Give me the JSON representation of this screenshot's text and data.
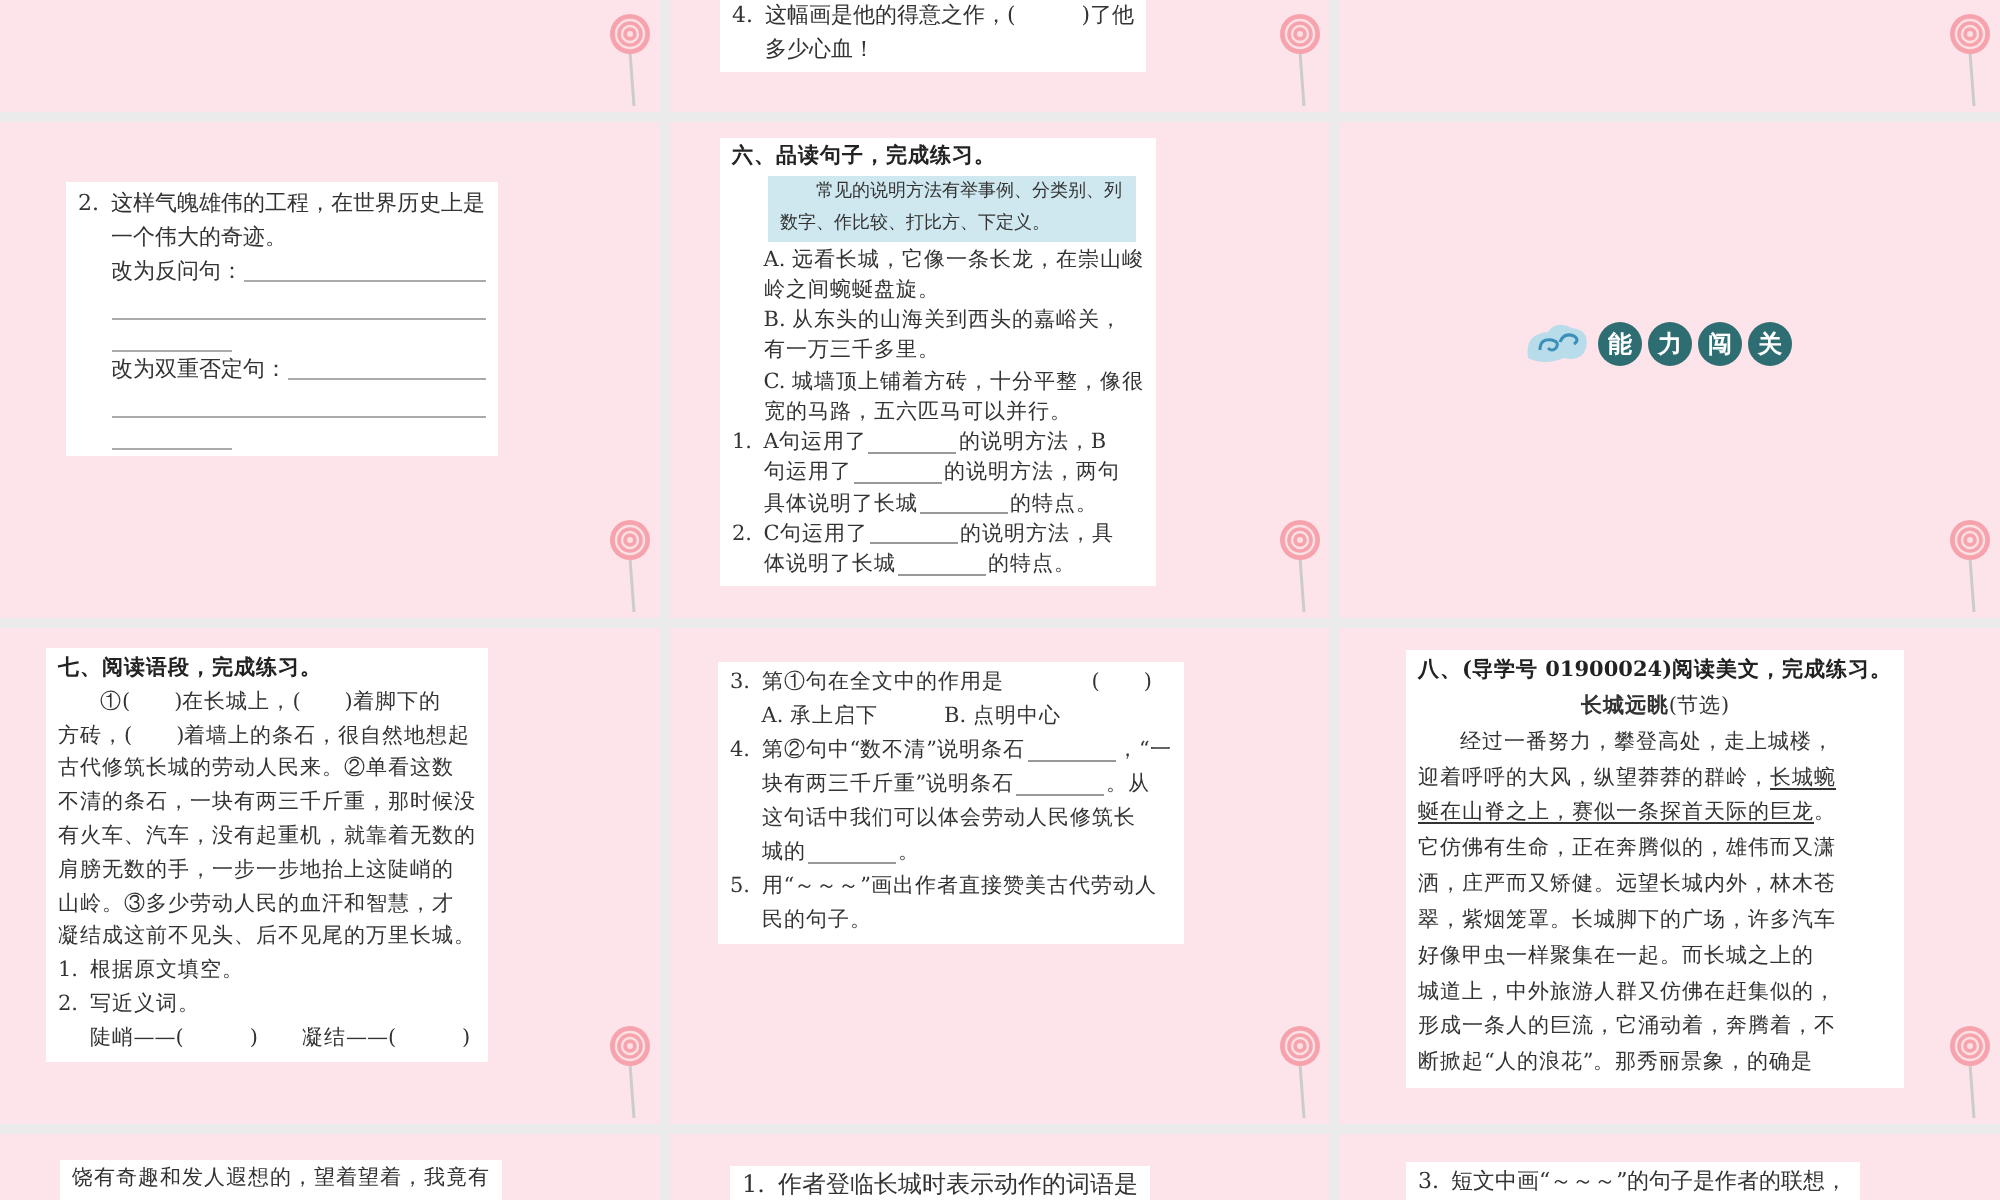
{
  "slides": [
    {
      "kind": "empty",
      "lollipop": true
    },
    {
      "kind": "worksheet",
      "lollipop": true,
      "blocks": [
        {
          "kind": "item",
          "number": "4.",
          "lines": [
            [
              {
                "kind": "text",
                "text": "这幅画是他的得意之作，(　　　)了他"
              }
            ],
            [
              {
                "kind": "text",
                "text": "多少心血！"
              }
            ]
          ]
        }
      ]
    },
    {
      "kind": "empty",
      "lollipop": true
    },
    {
      "kind": "worksheet",
      "lollipop": true,
      "blocks": [
        {
          "kind": "item",
          "number": "2.",
          "lines": [
            [
              {
                "kind": "text",
                "text": "这样气魄雄伟的工程，在世界历史上是"
              }
            ],
            [
              {
                "kind": "text",
                "text": "一个伟大的奇迹。"
              }
            ]
          ]
        },
        {
          "kind": "answer",
          "label": "改为反问句："
        },
        {
          "kind": "answer",
          "label": "改为双重否定句："
        }
      ]
    },
    {
      "kind": "worksheet",
      "lollipop": true,
      "blocks": [
        {
          "kind": "heading",
          "text": "六、品读句子，完成练习。"
        },
        {
          "kind": "note",
          "lines": [
            "常见的说明方法有举事例、分类别、列",
            "数字、作比较、打比方、下定义。"
          ]
        },
        {
          "kind": "sub",
          "lines": [
            [
              {
                "kind": "text",
                "text": "A. 远看长城，它像一条长龙，在崇山峻"
              }
            ],
            [
              {
                "kind": "text",
                "text": "岭之间蜿蜒盘旋。"
              }
            ]
          ]
        },
        {
          "kind": "sub",
          "lines": [
            [
              {
                "kind": "text",
                "text": "B. 从东头的山海关到西头的嘉峪关，"
              }
            ],
            [
              {
                "kind": "text",
                "text": "有一万三千多里。"
              }
            ]
          ]
        },
        {
          "kind": "sub",
          "lines": [
            [
              {
                "kind": "text",
                "text": "C. 城墙顶上铺着方砖，十分平整，像很"
              }
            ],
            [
              {
                "kind": "text",
                "text": "宽的马路，五六匹马可以并行。"
              }
            ]
          ]
        },
        {
          "kind": "item",
          "number": "1.",
          "lines": [
            [
              {
                "kind": "text",
                "text": "A句运用了"
              },
              {
                "kind": "blank"
              },
              {
                "kind": "text",
                "text": "的说明方法，B"
              }
            ],
            [
              {
                "kind": "text",
                "text": "句运用了"
              },
              {
                "kind": "blank"
              },
              {
                "kind": "text",
                "text": "的说明方法，两句"
              }
            ],
            [
              {
                "kind": "text",
                "text": "具体说明了长城"
              },
              {
                "kind": "blank"
              },
              {
                "kind": "text",
                "text": "的特点。"
              }
            ]
          ]
        },
        {
          "kind": "item",
          "number": "2.",
          "lines": [
            [
              {
                "kind": "text",
                "text": "C句运用了"
              },
              {
                "kind": "blank"
              },
              {
                "kind": "text",
                "text": "的说明方法，具"
              }
            ],
            [
              {
                "kind": "text",
                "text": "体说明了长城"
              },
              {
                "kind": "blank"
              },
              {
                "kind": "text",
                "text": "的特点。"
              }
            ]
          ]
        }
      ]
    },
    {
      "kind": "banner",
      "lollipop": true,
      "characters": [
        "能",
        "力",
        "闯",
        "关"
      ]
    },
    {
      "kind": "worksheet",
      "lollipop": true,
      "blocks": [
        {
          "kind": "heading",
          "text": "七、阅读语段，完成练习。"
        },
        {
          "kind": "para",
          "lines": [
            [
              {
                "kind": "text",
                "text": "①(　　)在长城上，(　　)着脚下的"
              }
            ],
            [
              {
                "kind": "text",
                "text": "方砖，(　　)着墙上的条石，很自然地想起"
              }
            ],
            [
              {
                "kind": "text",
                "text": "古代修筑长城的劳动人民来。②单看这数"
              }
            ],
            [
              {
                "kind": "text",
                "text": "不清的条石，一块有两三千斤重，那时候没"
              }
            ],
            [
              {
                "kind": "text",
                "text": "有火车、汽车，没有起重机，就靠着无数的"
              }
            ],
            [
              {
                "kind": "text",
                "text": "肩膀无数的手，一步一步地抬上这陡峭的"
              }
            ],
            [
              {
                "kind": "text",
                "text": "山岭。③多少劳动人民的血汗和智慧，才"
              }
            ],
            [
              {
                "kind": "text",
                "text": "凝结成这前不见头、后不见尾的万里长城。"
              }
            ]
          ]
        },
        {
          "kind": "item",
          "number": "1.",
          "lines": [
            [
              {
                "kind": "text",
                "text": "根据原文填空。"
              }
            ]
          ]
        },
        {
          "kind": "item",
          "number": "2.",
          "lines": [
            [
              {
                "kind": "text",
                "text": "写近义词。"
              }
            ]
          ]
        },
        {
          "kind": "sub",
          "lines": [
            [
              {
                "kind": "text",
                "text": "陡峭——(　　　)　　凝结——(　　　)"
              }
            ]
          ]
        }
      ]
    },
    {
      "kind": "worksheet",
      "lollipop": true,
      "blocks": [
        {
          "kind": "item",
          "number": "3.",
          "lines": [
            [
              {
                "kind": "text",
                "text": "第①句在全文中的作用是　　　　(　　)"
              }
            ]
          ]
        },
        {
          "kind": "sub",
          "lines": [
            [
              {
                "kind": "text",
                "text": "A. 承上启下　　　B. 点明中心"
              }
            ]
          ]
        },
        {
          "kind": "item",
          "number": "4.",
          "lines": [
            [
              {
                "kind": "text",
                "text": "第②句中“数不清”说明条石"
              },
              {
                "kind": "blank"
              },
              {
                "kind": "text",
                "text": "，“一"
              }
            ],
            [
              {
                "kind": "text",
                "text": "块有两三千斤重”说明条石"
              },
              {
                "kind": "blank"
              },
              {
                "kind": "text",
                "text": "。从"
              }
            ],
            [
              {
                "kind": "text",
                "text": "这句话中我们可以体会劳动人民修筑长"
              }
            ],
            [
              {
                "kind": "text",
                "text": "城的"
              },
              {
                "kind": "blank"
              },
              {
                "kind": "text",
                "text": "。"
              }
            ]
          ]
        },
        {
          "kind": "item",
          "number": "5.",
          "lines": [
            [
              {
                "kind": "text",
                "text": "用“～～～”画出作者直接赞美古代劳动人"
              }
            ],
            [
              {
                "kind": "text",
                "text": "民的句子。"
              }
            ]
          ]
        }
      ]
    },
    {
      "kind": "worksheet",
      "lollipop": true,
      "blocks": [
        {
          "kind": "heading",
          "text": "**八、**(导学号 01900024)**阅读美文，完成练习。**"
        },
        {
          "kind": "title",
          "text": "**长城远眺**(节选)"
        },
        {
          "kind": "para",
          "lines": [
            [
              {
                "kind": "text",
                "text": "经过一番努力，攀登高处，走上城楼，"
              }
            ],
            [
              {
                "kind": "text",
                "text": "迎着呼呼的大风，纵望莽莽的群岭，"
              },
              {
                "kind": "underlined",
                "text": "长城蜿"
              }
            ],
            [
              {
                "kind": "underlined",
                "text": "蜒在山脊之上，赛似一条探首天际的巨龙"
              },
              {
                "kind": "text",
                "text": "。"
              }
            ],
            [
              {
                "kind": "text",
                "text": "它仿佛有生命，正在奔腾似的，雄伟而又潇"
              }
            ],
            [
              {
                "kind": "text",
                "text": "洒，庄严而又矫健。远望长城内外，林木苍"
              }
            ],
            [
              {
                "kind": "text",
                "text": "翠，紫烟笼罩。长城脚下的广场，许多汽车"
              }
            ],
            [
              {
                "kind": "text",
                "text": "好像甲虫一样聚集在一起。而长城之上的"
              }
            ],
            [
              {
                "kind": "text",
                "text": "城道上，中外旅游人群又仿佛在赶集似的，"
              }
            ],
            [
              {
                "kind": "text",
                "text": "形成一条人的巨流，它涌动着，奔腾着，不"
              }
            ],
            [
              {
                "kind": "text",
                "text": "断掀起“人的浪花”。那秀丽景象，的确是"
              }
            ]
          ]
        }
      ]
    },
    {
      "kind": "worksheet",
      "lollipop": false,
      "blocks": [
        {
          "kind": "plain",
          "lines": [
            [
              {
                "kind": "text",
                "text": "饶有奇趣和发人遐想的，望着望着，我竟有"
              }
            ]
          ]
        }
      ]
    },
    {
      "kind": "worksheet",
      "lollipop": false,
      "blocks": [
        {
          "kind": "item",
          "number": "1.",
          "lines": [
            [
              {
                "kind": "text",
                "text": "作者登临长城时表示动作的词语是"
              }
            ]
          ]
        }
      ]
    },
    {
      "kind": "worksheet",
      "lollipop": false,
      "blocks": [
        {
          "kind": "item",
          "number": "3.",
          "lines": [
            [
              {
                "kind": "text",
                "text": "短文中画“～～～”的句子是作者的联想，"
              }
            ]
          ]
        }
      ]
    }
  ]
}
